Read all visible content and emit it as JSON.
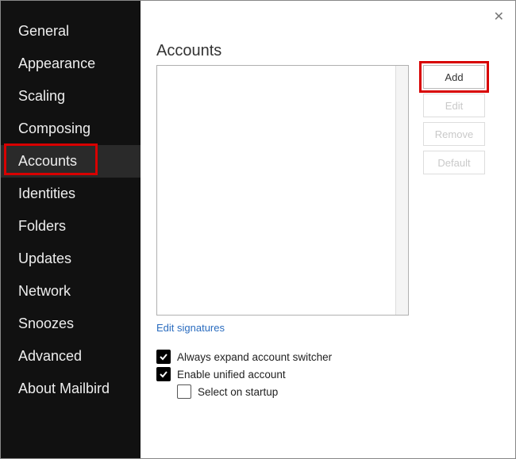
{
  "sidebar": {
    "items": [
      {
        "label": "General"
      },
      {
        "label": "Appearance"
      },
      {
        "label": "Scaling"
      },
      {
        "label": "Composing"
      },
      {
        "label": "Accounts"
      },
      {
        "label": "Identities"
      },
      {
        "label": "Folders"
      },
      {
        "label": "Updates"
      },
      {
        "label": "Network"
      },
      {
        "label": "Snoozes"
      },
      {
        "label": "Advanced"
      },
      {
        "label": "About Mailbird"
      }
    ],
    "selected_index": 4
  },
  "main": {
    "title": "Accounts",
    "buttons": {
      "add": "Add",
      "edit": "Edit",
      "remove": "Remove",
      "default": "Default"
    },
    "edit_signatures": "Edit signatures",
    "checks": {
      "always_expand": {
        "label": "Always expand account switcher",
        "checked": true
      },
      "enable_unified": {
        "label": "Enable unified account",
        "checked": true
      },
      "select_on_startup": {
        "label": "Select on startup",
        "checked": false
      }
    }
  }
}
